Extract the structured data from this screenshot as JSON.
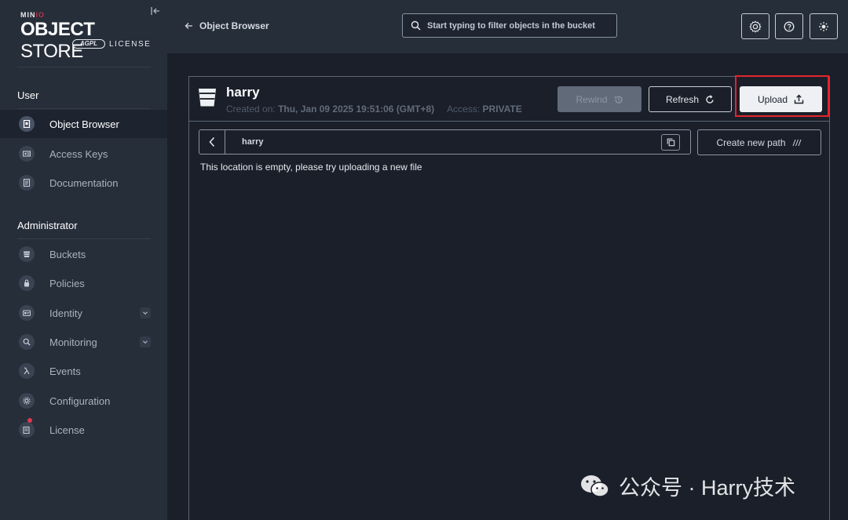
{
  "sidebar": {
    "logo": {
      "minio": "MINIO",
      "store": "OBJECT STORE",
      "agpl": "AGPL",
      "license": "LICENSE"
    },
    "sections": {
      "user": "User",
      "administrator": "Administrator"
    },
    "user_items": [
      {
        "label": "Object Browser",
        "icon": "object-browser-icon",
        "active": true
      },
      {
        "label": "Access Keys",
        "icon": "access-keys-icon"
      },
      {
        "label": "Documentation",
        "icon": "documentation-icon"
      }
    ],
    "admin_items": [
      {
        "label": "Buckets",
        "icon": "bucket-icon"
      },
      {
        "label": "Policies",
        "icon": "lock-icon"
      },
      {
        "label": "Identity",
        "icon": "identity-icon",
        "expandable": true
      },
      {
        "label": "Monitoring",
        "icon": "monitoring-icon",
        "expandable": true
      },
      {
        "label": "Events",
        "icon": "lambda-icon"
      },
      {
        "label": "Configuration",
        "icon": "gear-icon"
      },
      {
        "label": "License",
        "icon": "license-icon",
        "badge": true
      }
    ]
  },
  "header": {
    "back_label": "Object Browser",
    "search_placeholder": "Start typing to filter objects in the bucket",
    "icons": [
      "gear-icon",
      "help-icon",
      "theme-toggle-icon"
    ]
  },
  "bucket": {
    "name": "harry",
    "created_label": "Created on:",
    "created_value": "Thu, Jan 09 2025 19:51:06 (GMT+8)",
    "access_label": "Access:",
    "access_value": "PRIVATE"
  },
  "actions": {
    "rewind": "Rewind",
    "refresh": "Refresh",
    "upload": "Upload",
    "create_new_path": "Create new path"
  },
  "path": {
    "current": "harry"
  },
  "empty_message": "This location is empty, please try uploading a new file",
  "watermark": "公众号 · Harry技术",
  "colors": {
    "sidebar_bg": "#262e3a",
    "main_bg": "#1a1f2a",
    "highlight": "#e3242b",
    "badge": "#e0384e"
  }
}
